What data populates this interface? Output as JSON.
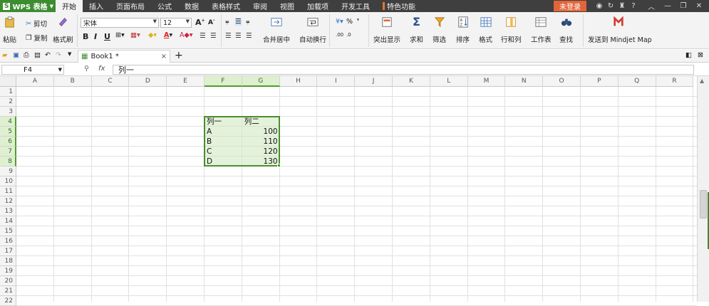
{
  "app": {
    "logo_mark": "S",
    "title": "WPS 表格",
    "menu_tabs": [
      "开始",
      "插入",
      "页面布局",
      "公式",
      "数据",
      "表格样式",
      "审阅",
      "视图",
      "加载项",
      "开发工具",
      "特色功能"
    ],
    "active_tab": "开始",
    "login_label": "未登录",
    "help_label": "?"
  },
  "ribbon": {
    "paste": "粘贴",
    "cut": "剪切",
    "copy": "复制",
    "format_painter": "格式刷",
    "font_name": "宋体",
    "font_size": "12",
    "bold": "B",
    "italic": "I",
    "underline": "U",
    "merge_center": "合并居中",
    "wrap_text": "自动换行",
    "percent": "%",
    "conditional": "突出显示",
    "sum": "求和",
    "filter": "筛选",
    "sort": "排序",
    "format": "格式",
    "row_col": "行和列",
    "worksheet": "工作表",
    "find": "查找",
    "send_mindjet": "发送到 Mindjet Map",
    "accent_orange": "#e2643a",
    "brand_green": "#3c8d2f"
  },
  "doc": {
    "tab_title": "Book1 *",
    "close": "×",
    "new_tab": "+"
  },
  "formula_bar": {
    "name_box": "F4",
    "fx_label": "fx",
    "content": "列一"
  },
  "grid": {
    "columns": [
      "A",
      "B",
      "C",
      "D",
      "E",
      "F",
      "G",
      "H",
      "I",
      "J",
      "K",
      "L",
      "M",
      "N",
      "O",
      "P",
      "Q",
      "R"
    ],
    "selected_columns": [
      "F",
      "G"
    ],
    "rows": [
      "1",
      "2",
      "3",
      "4",
      "5",
      "6",
      "7",
      "8",
      "9",
      "10",
      "11",
      "12",
      "13",
      "14",
      "15",
      "16",
      "17",
      "18",
      "19",
      "20",
      "21",
      "22"
    ],
    "selected_rows": [
      "4",
      "5",
      "6",
      "7",
      "8"
    ],
    "table": {
      "header": [
        "列一",
        "列二"
      ],
      "rows": [
        [
          "A",
          "100"
        ],
        [
          "B",
          "110"
        ],
        [
          "C",
          "120"
        ],
        [
          "D",
          "130"
        ]
      ]
    }
  }
}
